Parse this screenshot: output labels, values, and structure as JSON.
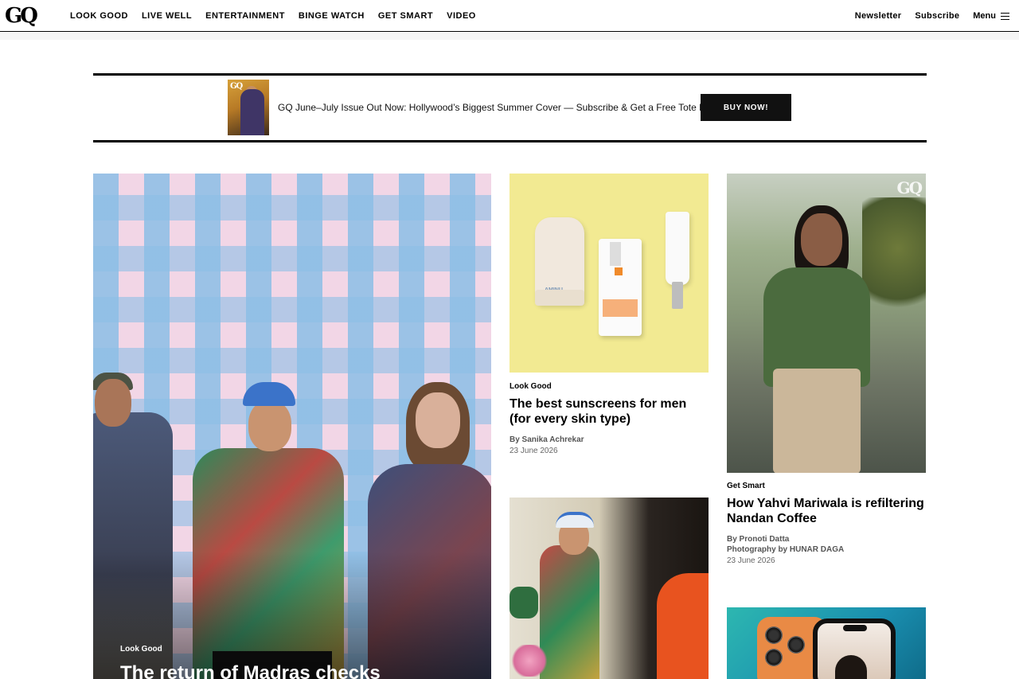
{
  "header": {
    "logo": "GQ",
    "nav": [
      "LOOK GOOD",
      "LIVE WELL",
      "ENTERTAINMENT",
      "BINGE WATCH",
      "GET SMART",
      "VIDEO"
    ],
    "newsletter": "Newsletter",
    "subscribe": "Subscribe",
    "menu": "Menu"
  },
  "promo": {
    "cover_logo": "GQ",
    "text": "GQ June–July Issue Out Now: Hollywood’s Biggest Summer Cover — Subscribe & Get a Free Tote Bag",
    "button": "BUY NOW!"
  },
  "feature": {
    "kicker": "Look Good",
    "title": "The return of Madras checks"
  },
  "cards": [
    {
      "kicker": "Look Good",
      "title": "The best sunscreens for men (for every skin type)",
      "byline": "By Sanika Achrekar",
      "date": "23 June 2026",
      "product_label": "AMINU"
    },
    {
      "kicker": "Get Smart",
      "title": "How Yahvi Mariwala is refiltering Nandan Coffee",
      "byline": "By Pronoti Datta",
      "credit": "Photography by HUNAR DAGA",
      "date": "23 June 2026",
      "watermark": "GQ"
    }
  ]
}
